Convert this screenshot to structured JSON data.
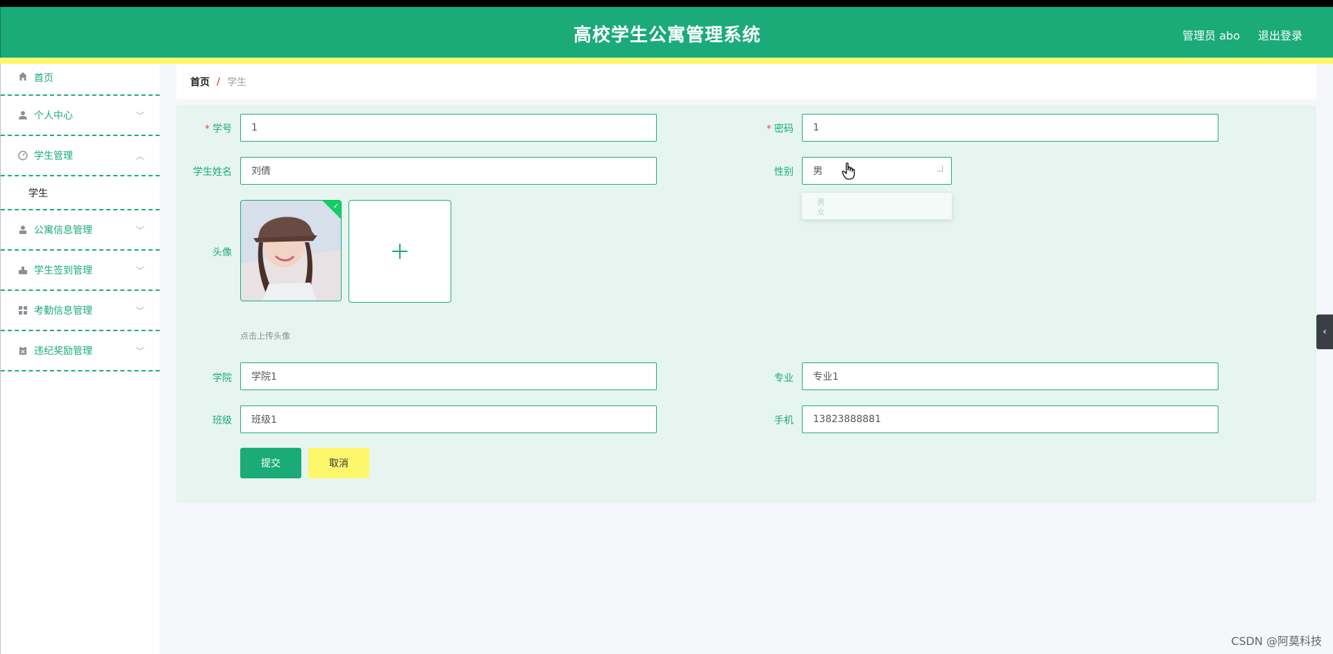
{
  "header": {
    "title": "高校学生公寓管理系统",
    "user": "管理员 abo",
    "logout": "退出登录"
  },
  "sidebar": {
    "items": [
      {
        "label": "首页",
        "icon": "home-icon"
      },
      {
        "label": "个人中心",
        "icon": "user-icon"
      },
      {
        "label": "学生管理",
        "icon": "gauge-icon",
        "expanded": true,
        "children": [
          "学生"
        ]
      },
      {
        "label": "公寓信息管理",
        "icon": "person-icon"
      },
      {
        "label": "学生签到管理",
        "icon": "stamp-icon"
      },
      {
        "label": "考勤信息管理",
        "icon": "grid-icon"
      },
      {
        "label": "违纪奖励管理",
        "icon": "clipboard-icon"
      }
    ]
  },
  "breadcrumb": {
    "home": "首页",
    "separator": "/",
    "current": "学生"
  },
  "form": {
    "student_id": {
      "label": "学号",
      "value": "1"
    },
    "password": {
      "label": "密码",
      "value": "1"
    },
    "name": {
      "label": "学生姓名",
      "value": "刘倩"
    },
    "gender": {
      "label": "性别",
      "value": "男",
      "options": [
        "男",
        "女"
      ]
    },
    "avatar": {
      "label": "头像",
      "tip": "点击上传头像"
    },
    "college": {
      "label": "学院",
      "value": "学院1"
    },
    "major": {
      "label": "专业",
      "value": "专业1"
    },
    "class": {
      "label": "班级",
      "value": "班级1"
    },
    "phone": {
      "label": "手机",
      "value": "13823888881"
    },
    "submit": "提交",
    "cancel": "取消"
  },
  "watermark": "CSDN @阿莫科技",
  "colors": {
    "primary": "#1aab79",
    "accent_yellow": "#fdf86b",
    "panel": "#e6f5ef"
  }
}
